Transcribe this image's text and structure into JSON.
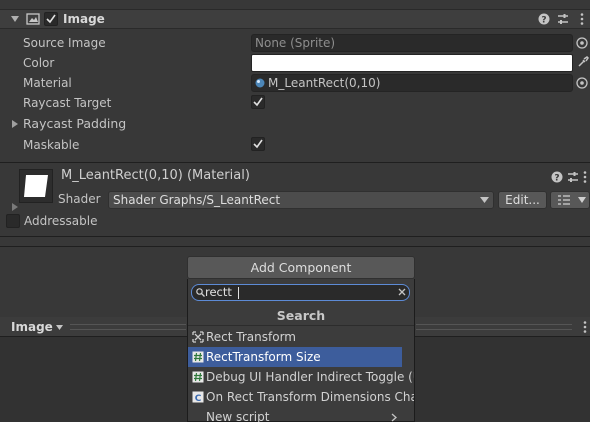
{
  "image_component": {
    "title": "Image",
    "rows": [
      {
        "label": "Source Image",
        "value": "None (Sprite)"
      },
      {
        "label": "Color",
        "value": ""
      },
      {
        "label": "Material",
        "value": "M_LeantRect(0,10)"
      },
      {
        "label": "Raycast Target",
        "checked": true
      },
      {
        "label": "Raycast Padding"
      },
      {
        "label": "Maskable",
        "checked": true
      }
    ]
  },
  "material": {
    "title": "M_LeantRect(0,10) (Material)",
    "shader_label": "Shader",
    "shader_value": "Shader Graphs/S_LeantRect",
    "edit_label": "Edit..."
  },
  "addressable_label": "Addressable",
  "add_component": {
    "button_label": "Add Component",
    "search_value": "rectt",
    "search_header": "Search",
    "results": [
      {
        "label": "Rect Transform",
        "icon": "rect-transform-icon",
        "selected": false
      },
      {
        "label": "RectTransform Size",
        "icon": "script-hash-icon",
        "selected": true
      },
      {
        "label": "Debug UI Handler Indirect Toggle (Un",
        "icon": "script-hash-icon",
        "selected": false
      },
      {
        "label": "On Rect Transform Dimensions Chang",
        "icon": "event-icon",
        "selected": false
      },
      {
        "label": "New script",
        "icon": "",
        "selected": false
      }
    ]
  },
  "preview": {
    "title": "Image"
  },
  "colors": {
    "background": "#383838",
    "header": "#3e3e3e",
    "field": "#2a2a2a",
    "selection": "#3d5d9c",
    "popup": "#3c3c3c"
  }
}
